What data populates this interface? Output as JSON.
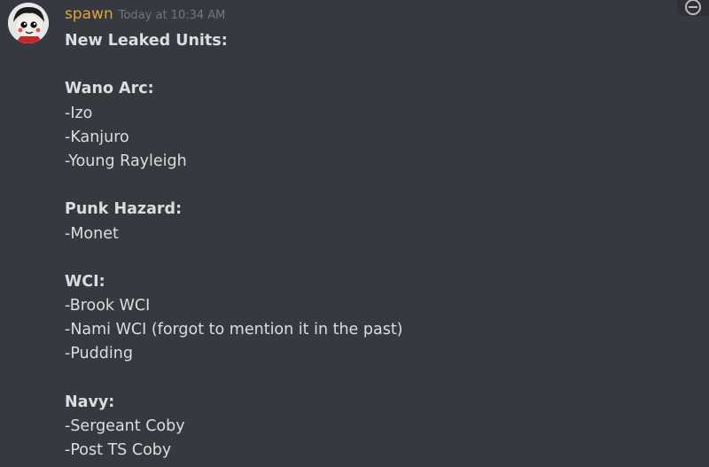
{
  "message": {
    "author": "spawn",
    "timestamp": "Today at 10:34 AM",
    "lines": [
      {
        "text": "New Leaked Units:",
        "bold": true
      },
      {
        "text": "",
        "bold": false
      },
      {
        "text": "Wano Arc:",
        "bold": true
      },
      {
        "text": "-Izo",
        "bold": false
      },
      {
        "text": "-Kanjuro",
        "bold": false
      },
      {
        "text": "-Young Rayleigh",
        "bold": false
      },
      {
        "text": "",
        "bold": false
      },
      {
        "text": "Punk Hazard:",
        "bold": true
      },
      {
        "text": "-Monet",
        "bold": false
      },
      {
        "text": "",
        "bold": false
      },
      {
        "text": "WCI:",
        "bold": true
      },
      {
        "text": "-Brook WCI",
        "bold": false
      },
      {
        "text": "-Nami WCI (forgot to mention it in the past)",
        "bold": false
      },
      {
        "text": "-Pudding",
        "bold": false
      },
      {
        "text": "",
        "bold": false
      },
      {
        "text": "Navy:",
        "bold": true
      },
      {
        "text": "-Sergeant Coby",
        "bold": false
      },
      {
        "text": "-Post TS Coby",
        "bold": false
      }
    ]
  },
  "icons": {
    "avatar": "avatar-image",
    "reaction": "add-reaction-icon"
  },
  "colors": {
    "background": "#36393f",
    "username": "#e3a23d",
    "timestamp": "#72767d",
    "text": "#dcddde"
  }
}
